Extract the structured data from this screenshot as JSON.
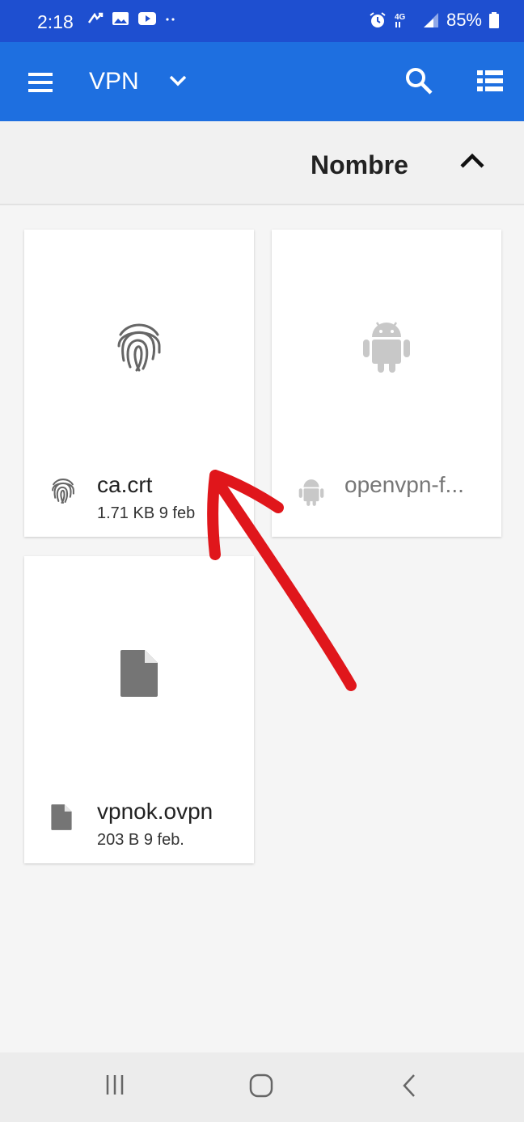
{
  "status_bar": {
    "time": "2:18",
    "battery": "85%",
    "left_icons": [
      "missed-call-icon",
      "image-icon",
      "youtube-icon",
      "more-dots-icon"
    ],
    "right_icons": [
      "alarm-icon",
      "4g-icon",
      "signal-icon",
      "battery-icon"
    ]
  },
  "app_bar": {
    "title": "VPN",
    "color": "#1e6fe0",
    "status_color": "#1e4fd0"
  },
  "sort": {
    "label": "Nombre",
    "direction_icon": "chevron-up-icon"
  },
  "files": [
    {
      "name": "ca.crt",
      "size": "1.71 KB",
      "date": "9 feb",
      "icon": "fingerprint-icon"
    },
    {
      "name": "openvpn-f...",
      "icon": "android-icon"
    },
    {
      "name": "vpnok.ovpn",
      "size": "203 B",
      "date": "9 feb.",
      "icon": "file-icon"
    }
  ],
  "nav": {
    "icons": [
      "recent-apps-icon",
      "home-icon",
      "back-icon"
    ]
  },
  "annotation": {
    "color": "#e0161b",
    "shape": "hand-drawn-arrow"
  }
}
